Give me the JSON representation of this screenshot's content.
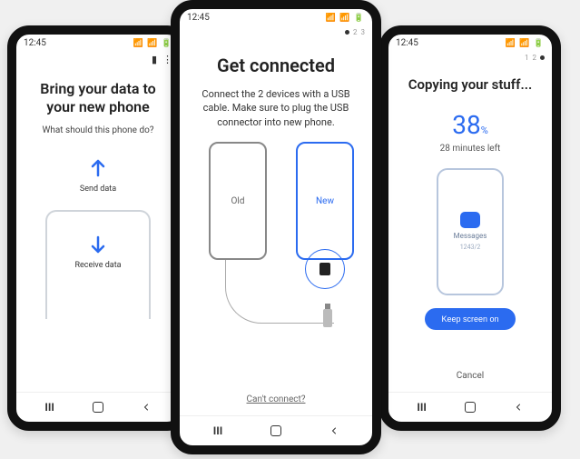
{
  "status": {
    "time": "12:45"
  },
  "phone1": {
    "title_line1": "Bring your data to",
    "title_line2": "your new phone",
    "subtitle": "What should this phone do?",
    "send_label": "Send data",
    "receive_label": "Receive data"
  },
  "phone2": {
    "step_labels": [
      "1",
      "2",
      "3"
    ],
    "active_step": 1,
    "title": "Get connected",
    "body": "Connect the 2 devices with a USB cable. Make sure to plug the USB connector into new phone.",
    "old_label": "Old",
    "new_label": "New",
    "cant_connect": "Can't connect?"
  },
  "phone3": {
    "step_labels": [
      "1",
      "2",
      "3"
    ],
    "active_step": 3,
    "title": "Copying your stuff...",
    "percent_value": "38",
    "percent_unit": "%",
    "time_left": "28 minutes left",
    "category_label": "Messages",
    "category_count": "1243/2",
    "button": "Keep screen on",
    "cancel": "Cancel"
  }
}
